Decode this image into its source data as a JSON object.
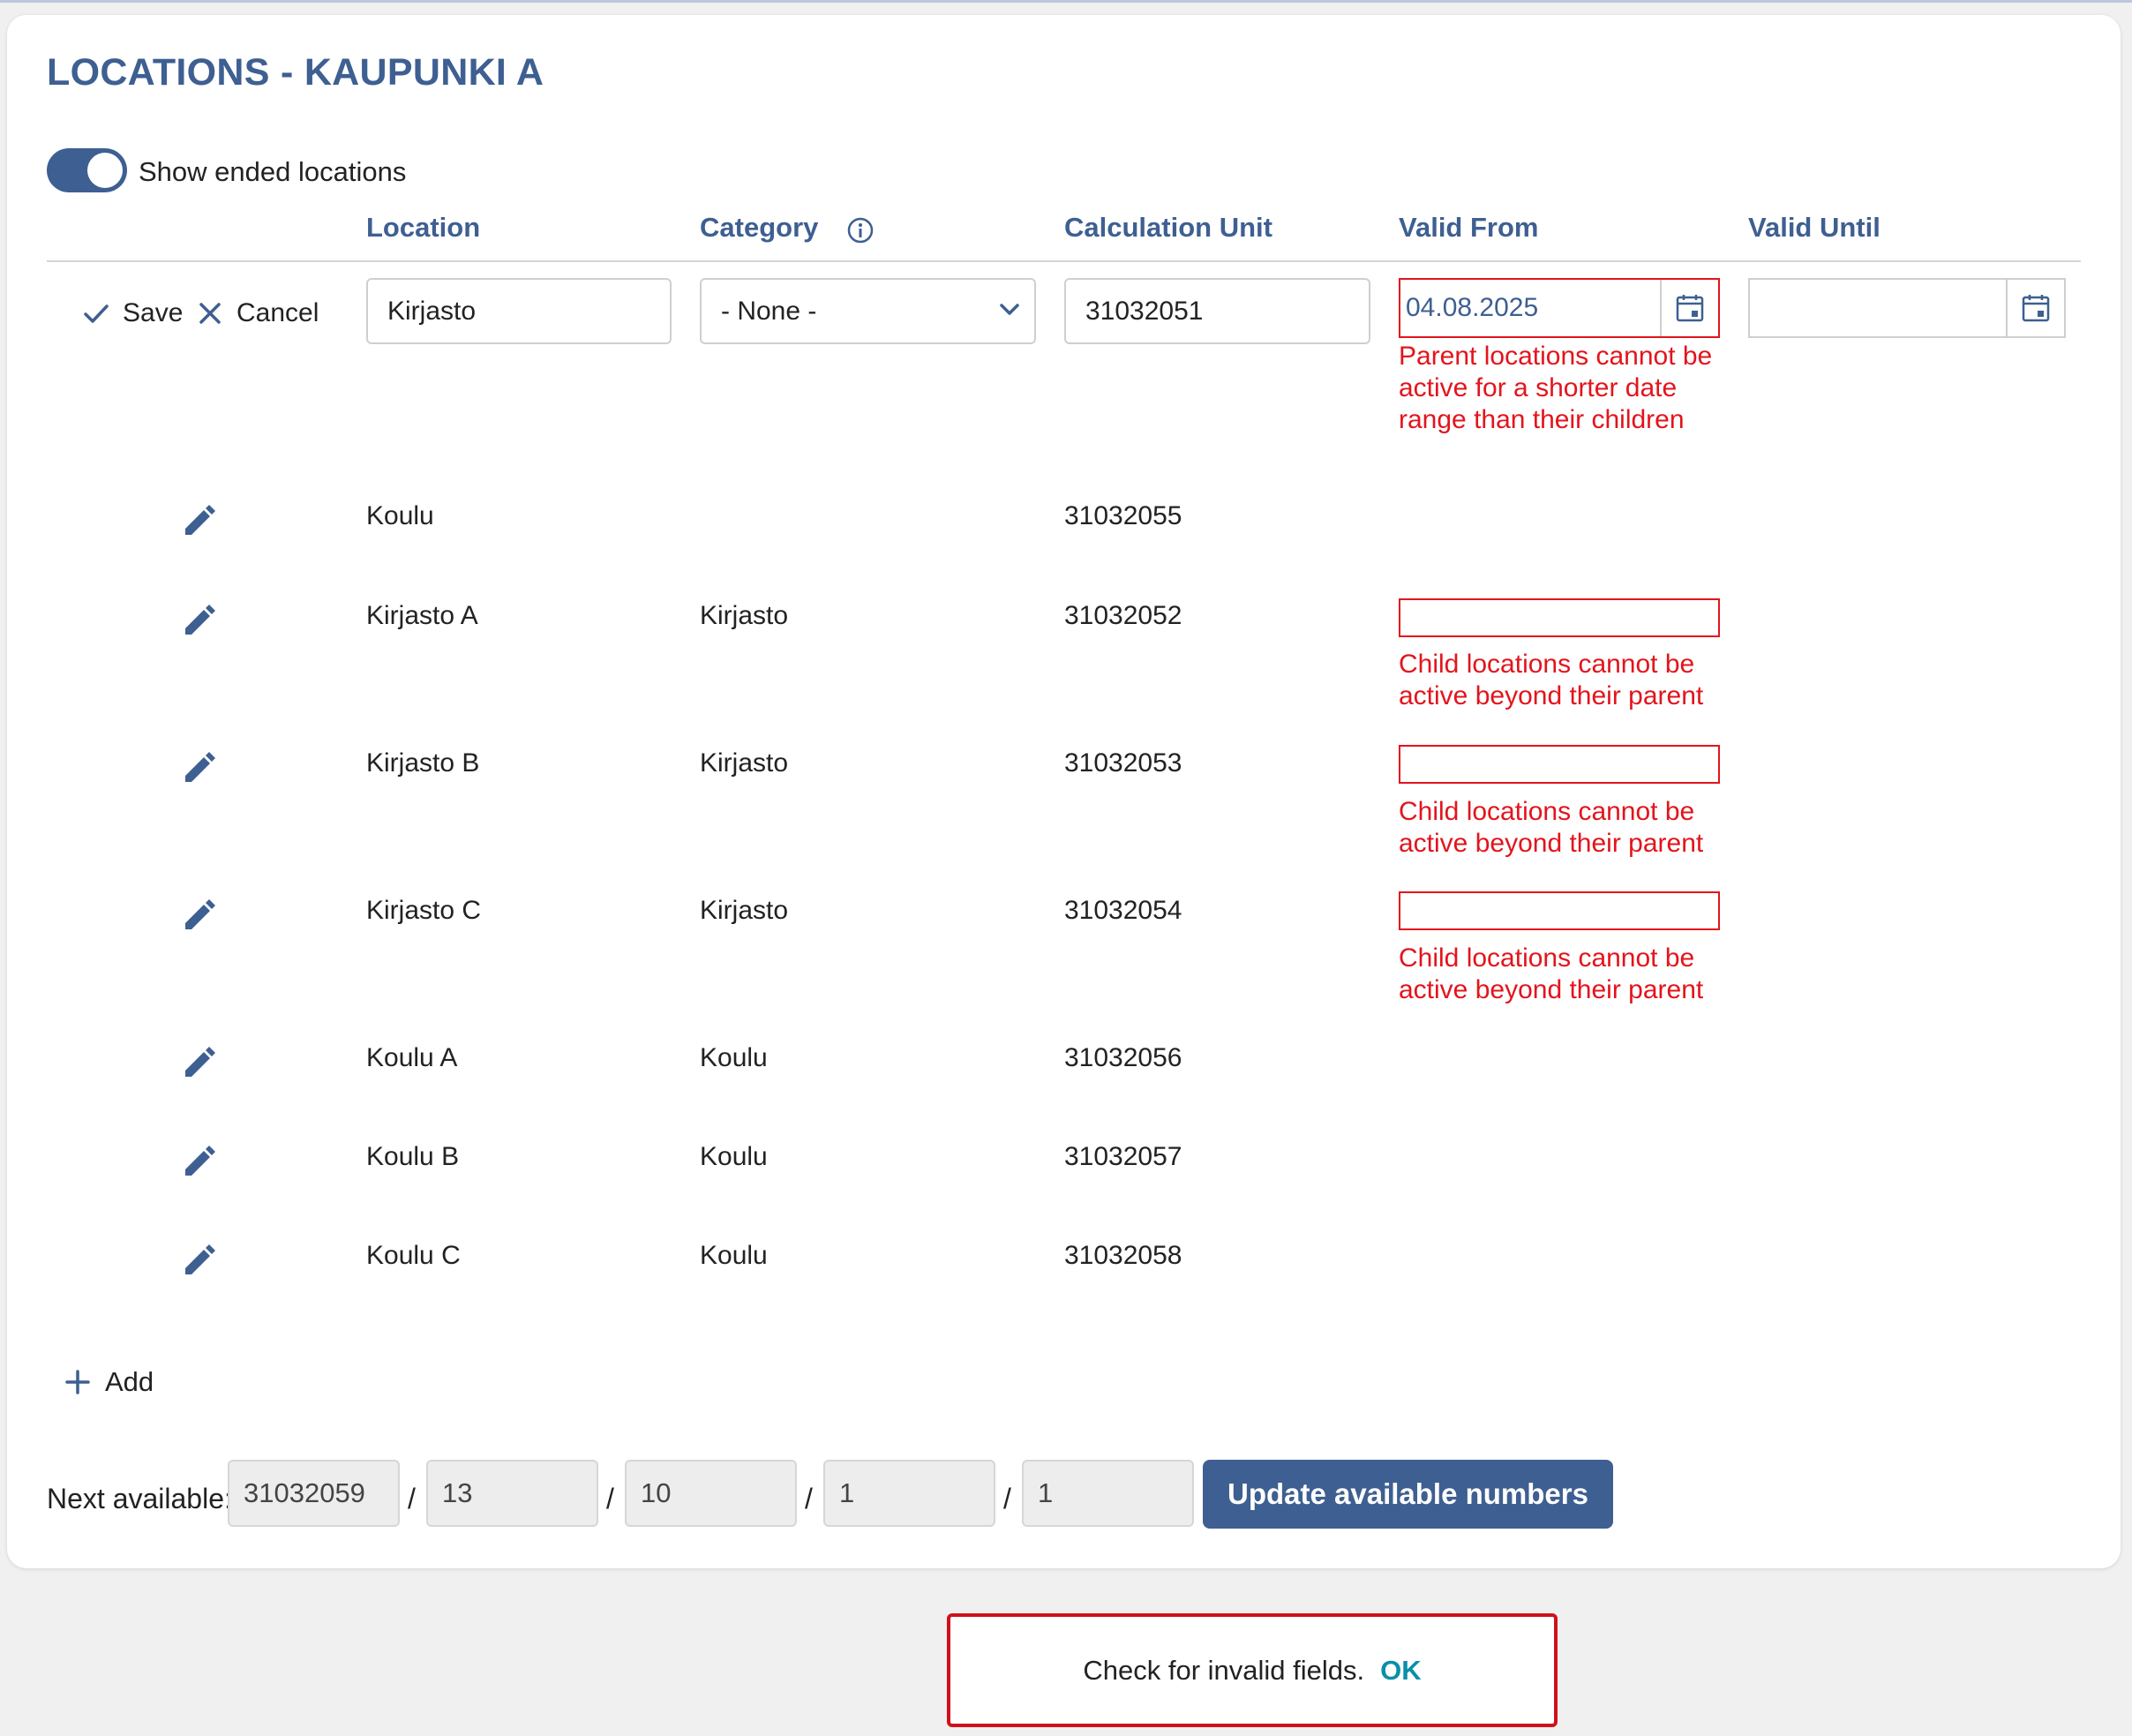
{
  "page": {
    "title": "LOCATIONS - KAUPUNKI A"
  },
  "toggle": {
    "label": "Show ended locations",
    "on": true
  },
  "headers": {
    "location": "Location",
    "category": "Category",
    "calc_unit": "Calculation Unit",
    "valid_from": "Valid From",
    "valid_until": "Valid Until"
  },
  "icons": {
    "info": "info-icon",
    "check": "check-icon",
    "close": "close-icon",
    "chevron": "chevron-down-icon",
    "calendar": "calendar-icon",
    "pencil": "pencil-icon",
    "plus": "plus-icon"
  },
  "colors": {
    "accent": "#3e5f91",
    "error": "#e3141c",
    "link": "#0b8fa8"
  },
  "edit_row": {
    "save_label": "Save",
    "cancel_label": "Cancel",
    "location_value": "Kirjasto",
    "category_value": "- None -",
    "calc_unit_value": "31032051",
    "valid_from_value": "04.08.2025",
    "valid_until_value": "",
    "error": "Parent locations cannot be active for a shorter date range than their children"
  },
  "rows": [
    {
      "location": "Koulu",
      "category": "",
      "calc_unit": "31032055",
      "error": ""
    },
    {
      "location": "Kirjasto A",
      "category": "Kirjasto",
      "calc_unit": "31032052",
      "error": "Child locations cannot be active beyond their parent"
    },
    {
      "location": "Kirjasto B",
      "category": "Kirjasto",
      "calc_unit": "31032053",
      "error": "Child locations cannot be active beyond their parent"
    },
    {
      "location": "Kirjasto C",
      "category": "Kirjasto",
      "calc_unit": "31032054",
      "error": "Child locations cannot be active beyond their parent"
    },
    {
      "location": "Koulu A",
      "category": "Koulu",
      "calc_unit": "31032056",
      "error": ""
    },
    {
      "location": "Koulu B",
      "category": "Koulu",
      "calc_unit": "31032057",
      "error": ""
    },
    {
      "location": "Koulu C",
      "category": "Koulu",
      "calc_unit": "31032058",
      "error": ""
    }
  ],
  "add_label": "Add",
  "next_available": {
    "label": "Next available:",
    "values": [
      "31032059",
      "13",
      "10",
      "1",
      "1"
    ],
    "separator": "/",
    "button_label": "Update available numbers"
  },
  "toast": {
    "message": "Check for invalid fields.",
    "ok_label": "OK"
  }
}
